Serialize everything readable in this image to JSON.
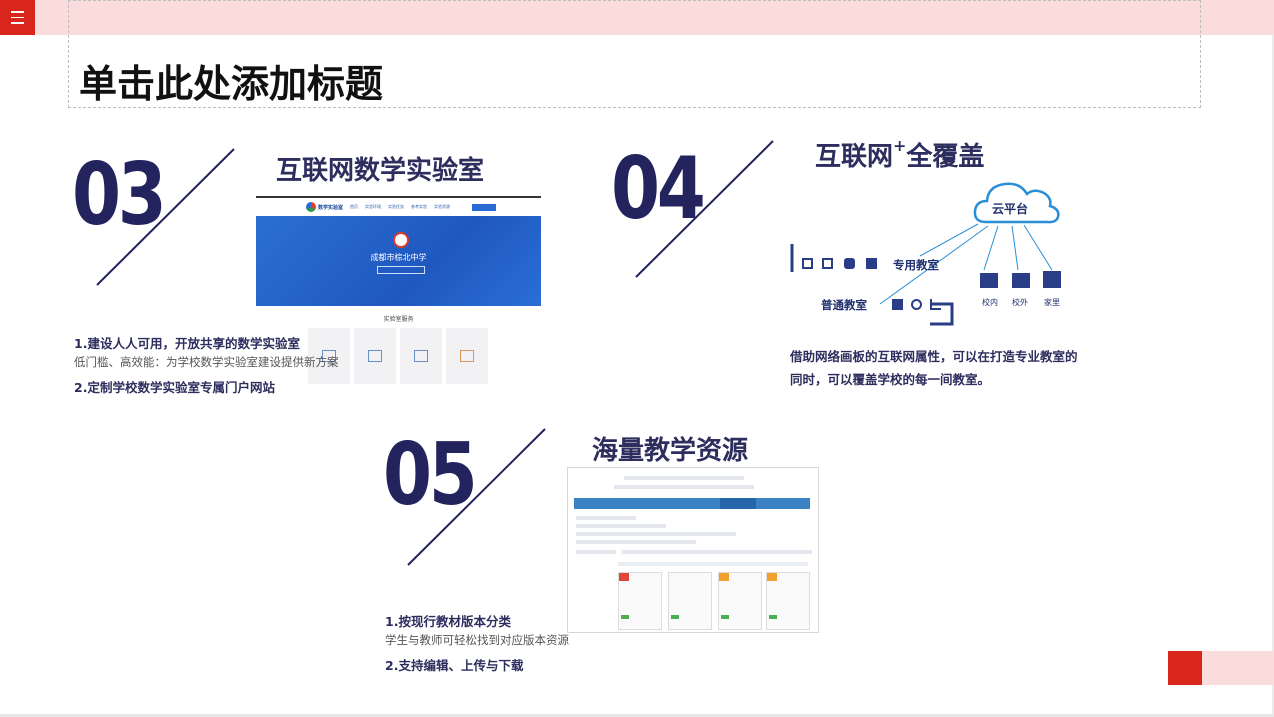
{
  "slide": {
    "title": "单击此处添加标题",
    "accent_color": "#d9261c",
    "pink_color": "#fadcdc",
    "navy_color": "#23235e"
  },
  "section03": {
    "number": "03",
    "heading": "互联网数学实验室",
    "point1": "1.建设人人可用，开放共享的数学实验室",
    "point1_desc": "低门槛、高效能：为学校数学实验室建设提供新方案",
    "point2": "2.定制学校数学实验室专属门户网站",
    "mock": {
      "logo_text": "数学实验室",
      "nav": [
        "首页",
        "实验环境",
        "实验任务",
        "参考实验",
        "实验资源"
      ],
      "school": "成都市棕北中学",
      "services": "实验室服务"
    }
  },
  "section04": {
    "number": "04",
    "heading": "互联网",
    "heading_sup": "+",
    "heading_rest": "全覆盖",
    "cloud": "云平台",
    "special_room": "专用教室",
    "normal_room": "普通教室",
    "campus_in": "校内",
    "campus_out": "校外",
    "home": "家里",
    "desc_line1": "借助网络画板的互联网属性，可以在打造专业教室的",
    "desc_line2": "同时，可以覆盖学校的每一间教室。"
  },
  "section05": {
    "number": "05",
    "heading": "海量教学资源",
    "point1": "1.按现行教材版本分类",
    "point1_desc": "学生与教师可轻松找到对应版本资源",
    "point2": "2.支持编辑、上传与下载"
  },
  "icons": [
    "menu-icon",
    "cloud-icon",
    "building-icon",
    "school-icon",
    "house-icon",
    "chart-icon",
    "book-icon"
  ]
}
